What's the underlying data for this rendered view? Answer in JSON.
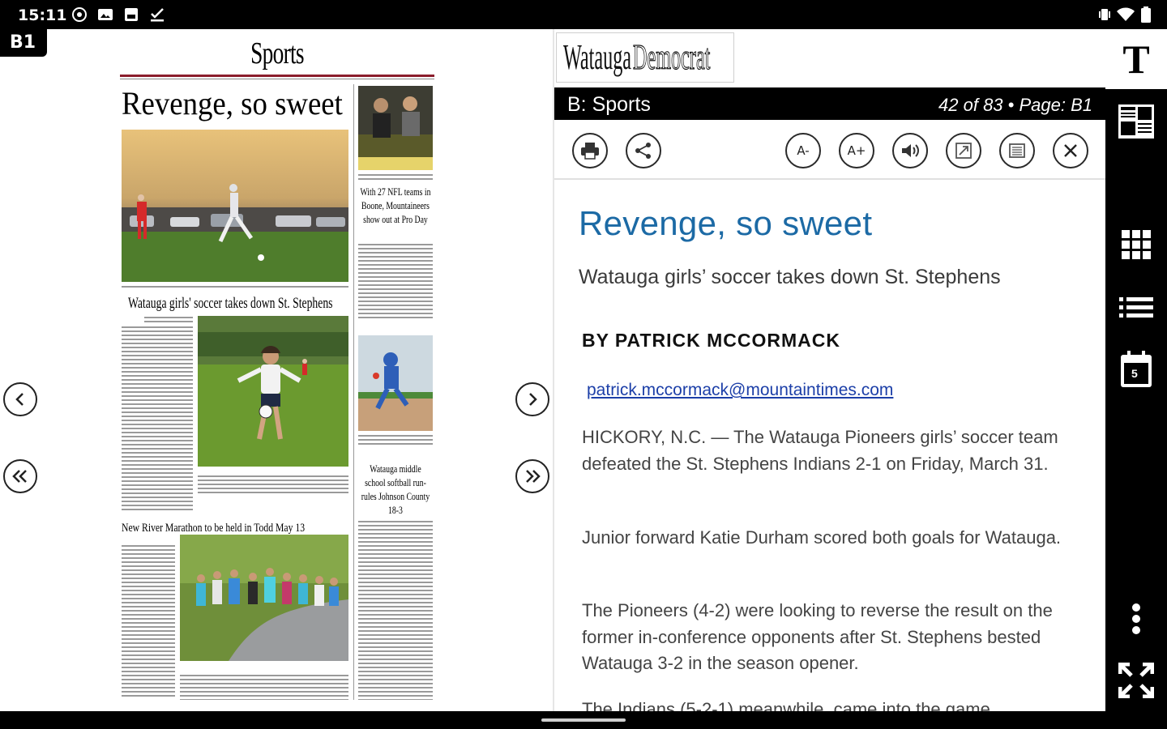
{
  "status_bar": {
    "time": "15:11",
    "left_icons": [
      "vpn-icon",
      "image-icon",
      "gallery-icon",
      "checklist-icon"
    ],
    "right_icons": [
      "vibrate-icon",
      "wifi-icon",
      "battery-icon"
    ]
  },
  "page_viewer": {
    "page_label": "B1",
    "newspaper": {
      "section": "Sports",
      "main_headline": "Revenge, so sweet",
      "main_subhead": "Watauga girls' soccer takes down St. Stephens",
      "side_headline_1": "With 27 NFL teams in Boone, Mountaineers show out at Pro Day",
      "side_headline_2": "Watauga middle school softball run-rules Johnson County 18-3",
      "bottom_headline": "New River Marathon to be held in Todd May 13"
    }
  },
  "publication": {
    "logo_part1": "Watauga",
    "logo_part2": "Democrat"
  },
  "section_bar": {
    "section": "B: Sports",
    "page_info": "42 of 83 • Page: B1"
  },
  "toolbar": {
    "font_smaller": "A-",
    "font_larger": "A+"
  },
  "article": {
    "title": "Revenge, so sweet",
    "subtitle": "Watauga girls’ soccer takes down St. Stephens",
    "byline": "BY PATRICK MCCORMACK",
    "email": "patrick.mccormack@mountaintimes.com",
    "paragraphs": [
      "HICKORY, N.C. — The Watauga Pioneers girls’ soccer team defeated the St. Stephens Indians 2-1 on Friday, March 31.",
      "Junior forward Katie Durham scored both goals for Watauga.",
      "The Pioneers (4-2) were looking to reverse the result on the former in-conference opponents after St. Stephens bested Watauga 3-2 in the season opener.",
      "The Indians (5-2-1) meanwhile, came into the game"
    ]
  },
  "rail": {
    "text_mode": "T",
    "calendar_day": "5"
  },
  "colors": {
    "title_blue": "#1c6aa5",
    "link_blue": "#1c3fa8",
    "masthead_red": "#8b1d2c"
  }
}
